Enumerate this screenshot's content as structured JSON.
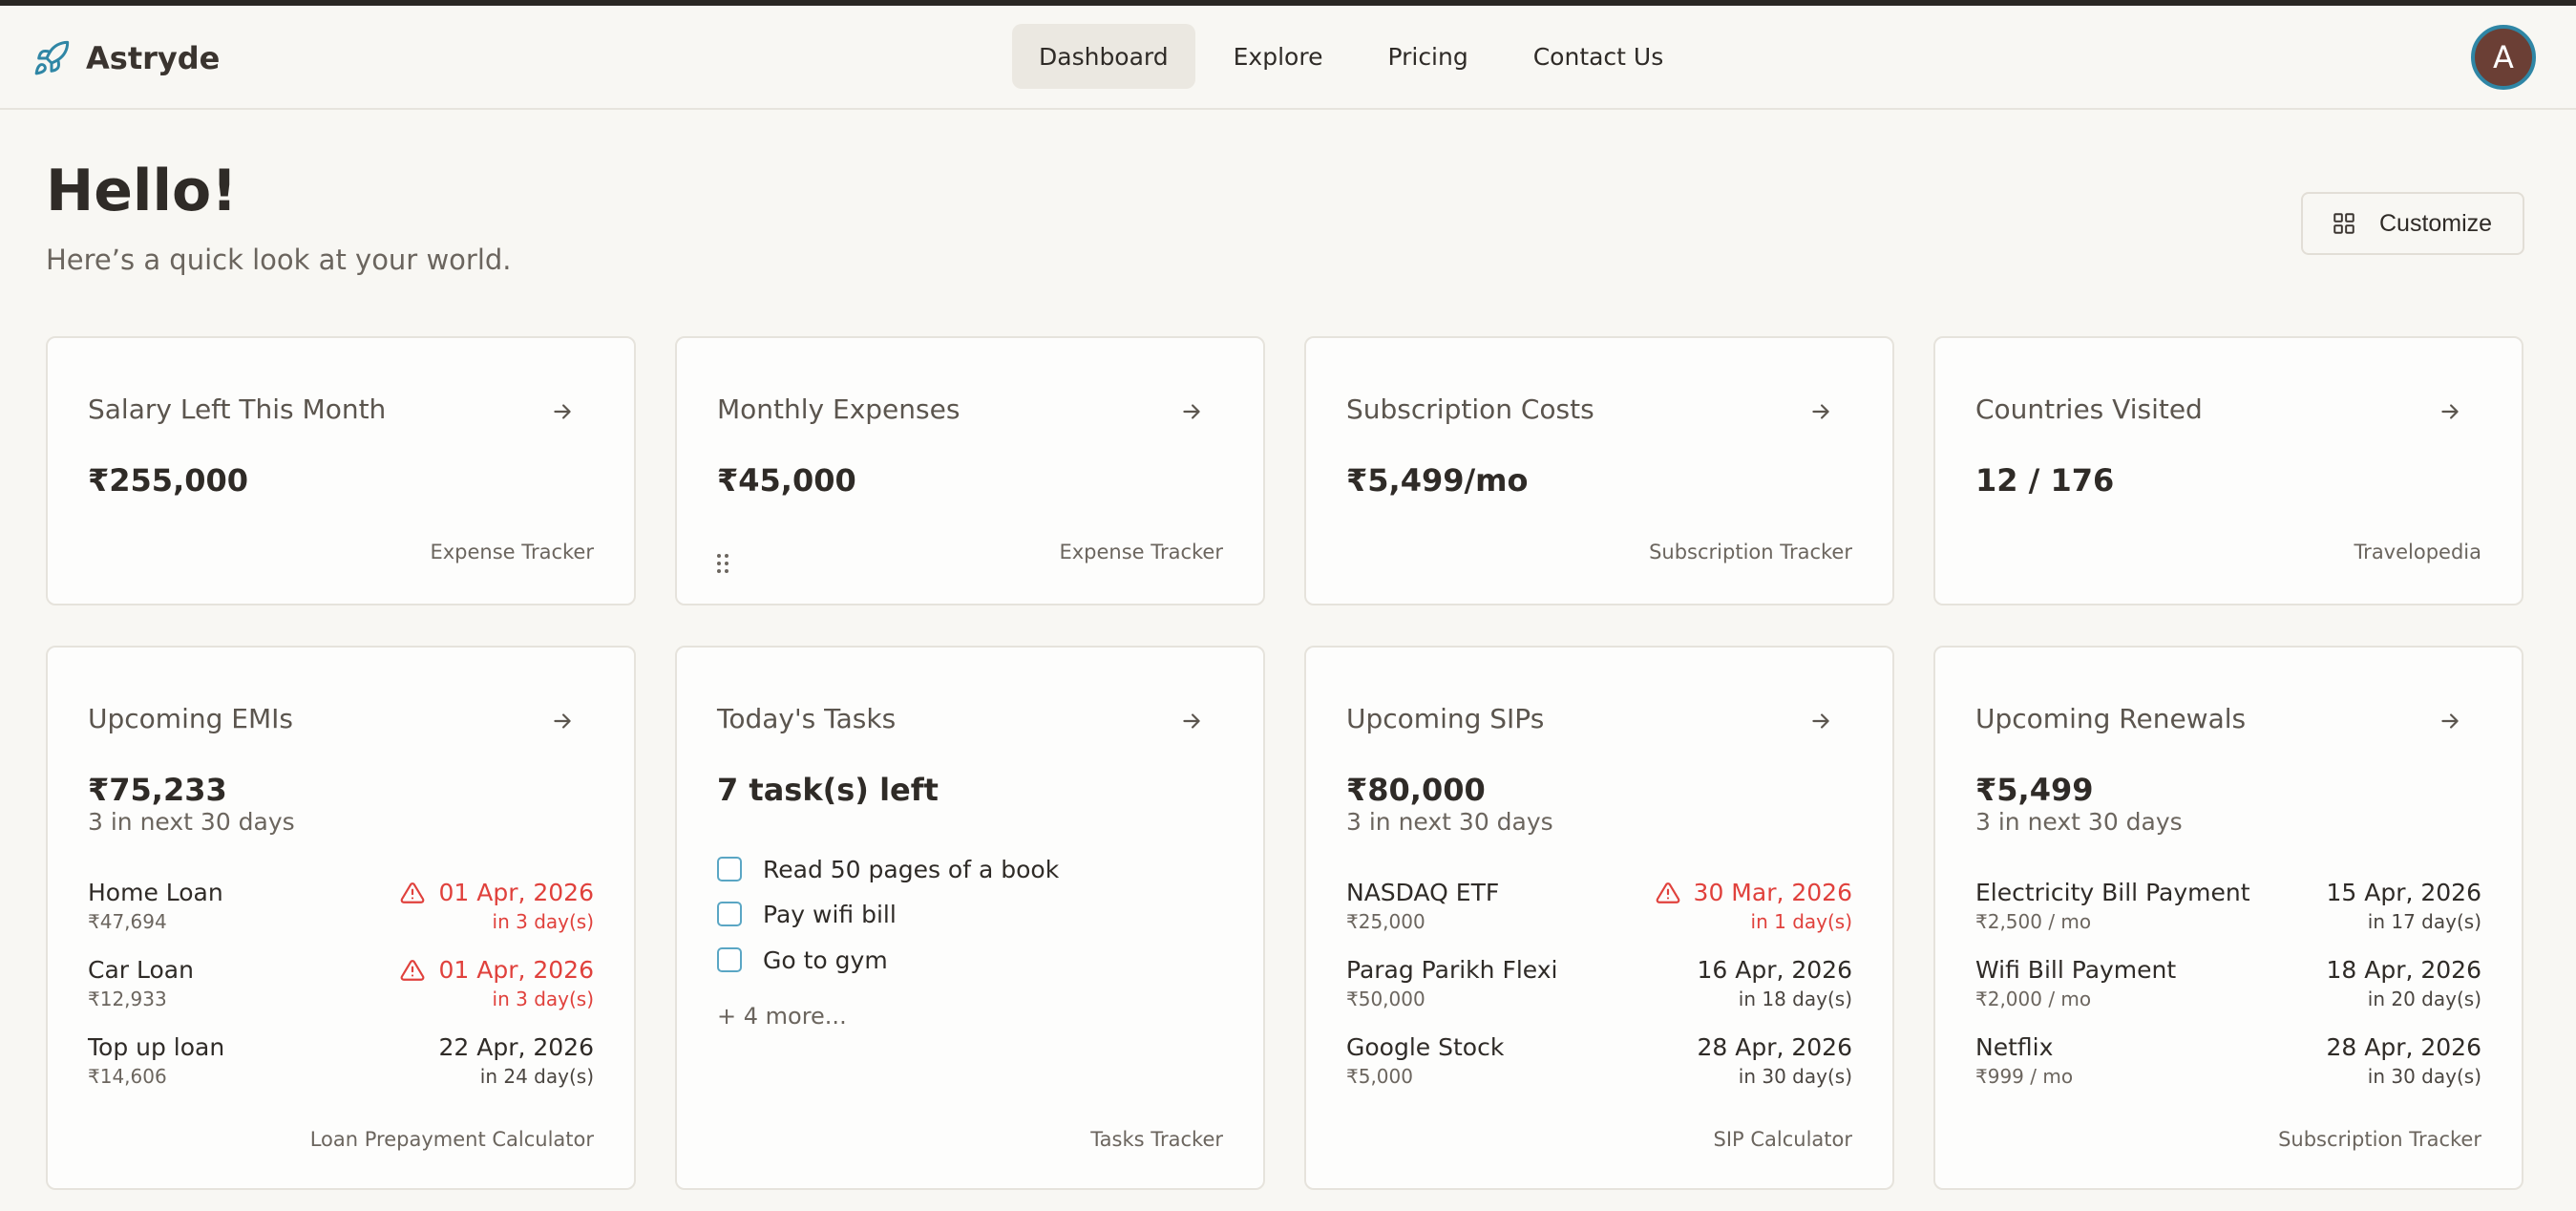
{
  "app": {
    "name": "Astryde",
    "avatar_initial": "A"
  },
  "nav": {
    "links": [
      "Dashboard",
      "Explore",
      "Pricing",
      "Contact Us"
    ],
    "active": "Dashboard"
  },
  "greeting": {
    "title": "Hello!",
    "subtitle": "Here’s a quick look at your world."
  },
  "customize_label": "Customize",
  "colors": {
    "background": "#f8f7f3",
    "urgent": "#e0413c",
    "accent": "#2f86a5"
  },
  "summary_cards": [
    {
      "title": "Salary Left This Month",
      "value": "₹255,000",
      "footer": "Expense Tracker"
    },
    {
      "title": "Monthly Expenses",
      "value": "₹45,000",
      "footer": "Expense Tracker"
    },
    {
      "title": "Subscription Costs",
      "value": "₹5,499/mo",
      "footer": "Subscription Tracker"
    },
    {
      "title": "Countries Visited",
      "value": "12 / 176",
      "footer": "Travelopedia"
    }
  ],
  "emis": {
    "title": "Upcoming EMIs",
    "total": "₹75,233",
    "summary": "3 in next 30 days",
    "footer": "Loan Prepayment Calculator",
    "items": [
      {
        "name": "Home Loan",
        "amount": "₹47,694",
        "date": "01 Apr, 2026",
        "due": "in 3 day(s)",
        "urgent": true
      },
      {
        "name": "Car Loan",
        "amount": "₹12,933",
        "date": "01 Apr, 2026",
        "due": "in 3 day(s)",
        "urgent": true
      },
      {
        "name": "Top up loan",
        "amount": "₹14,606",
        "date": "22 Apr, 2026",
        "due": "in 24 day(s)",
        "urgent": false
      }
    ]
  },
  "tasks": {
    "title": "Today's Tasks",
    "summary": "7 task(s) left",
    "footer": "Tasks Tracker",
    "more": "+ 4 more...",
    "items": [
      "Read 50 pages of a book",
      "Pay wifi bill",
      "Go to gym"
    ]
  },
  "sips": {
    "title": "Upcoming SIPs",
    "total": "₹80,000",
    "summary": "3 in next 30 days",
    "footer": "SIP Calculator",
    "items": [
      {
        "name": "NASDAQ ETF",
        "amount": "₹25,000",
        "date": "30 Mar, 2026",
        "due": "in 1 day(s)",
        "urgent": true
      },
      {
        "name": "Parag Parikh Flexi",
        "amount": "₹50,000",
        "date": "16 Apr, 2026",
        "due": "in 18 day(s)",
        "urgent": false
      },
      {
        "name": "Google Stock",
        "amount": "₹5,000",
        "date": "28 Apr, 2026",
        "due": "in 30 day(s)",
        "urgent": false
      }
    ]
  },
  "renewals": {
    "title": "Upcoming Renewals",
    "total": "₹5,499",
    "summary": "3 in next 30 days",
    "footer": "Subscription Tracker",
    "items": [
      {
        "name": "Electricity Bill Payment",
        "amount": "₹2,500 / mo",
        "date": "15 Apr, 2026",
        "due": "in 17 day(s)",
        "urgent": false
      },
      {
        "name": "Wifi Bill Payment",
        "amount": "₹2,000 / mo",
        "date": "18 Apr, 2026",
        "due": "in 20 day(s)",
        "urgent": false
      },
      {
        "name": "Netflix",
        "amount": "₹999 / mo",
        "date": "28 Apr, 2026",
        "due": "in 30 day(s)",
        "urgent": false
      }
    ]
  }
}
